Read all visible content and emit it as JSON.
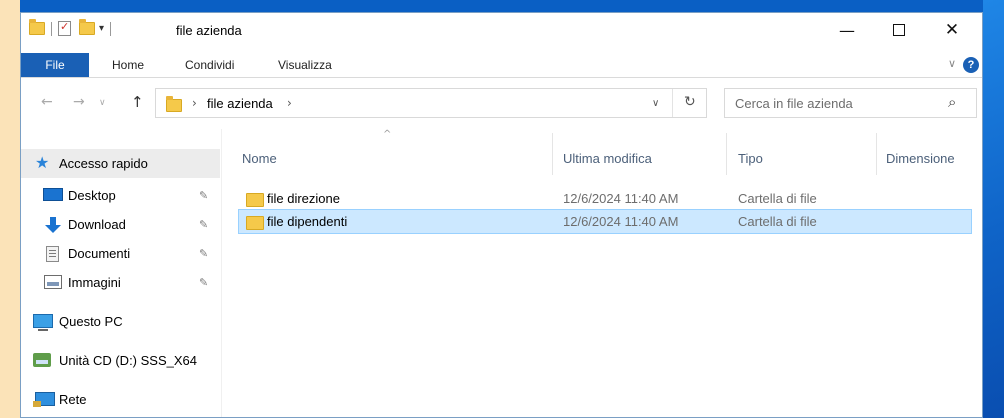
{
  "window": {
    "title": "file azienda"
  },
  "title_buttons": {
    "minimize": "—",
    "maximize": "",
    "close": "✕"
  },
  "ribbon": {
    "tabs": [
      "File",
      "Home",
      "Condividi",
      "Visualizza"
    ],
    "help": "?"
  },
  "nav": {
    "back": "←",
    "forward": "→",
    "recent": "∨",
    "up": "↑",
    "path": "file azienda",
    "dropdown": "∨",
    "refresh": "↻"
  },
  "search": {
    "placeholder": "Cerca in file azienda",
    "value": ""
  },
  "sidebar": {
    "items": [
      {
        "label": "Accesso rapido",
        "icon": "star-icon",
        "pinned": false
      },
      {
        "label": "Desktop",
        "icon": "desktop-icon",
        "pinned": true
      },
      {
        "label": "Download",
        "icon": "download-icon",
        "pinned": true
      },
      {
        "label": "Documenti",
        "icon": "documents-icon",
        "pinned": true
      },
      {
        "label": "Immagini",
        "icon": "pictures-icon",
        "pinned": true
      },
      {
        "label": "Questo PC",
        "icon": "pc-icon",
        "pinned": false
      },
      {
        "label": "Unità CD (D:) SSS_X64",
        "icon": "cd-drive-icon",
        "pinned": false
      },
      {
        "label": "Rete",
        "icon": "network-icon",
        "pinned": false
      }
    ]
  },
  "columns": {
    "name": "Nome",
    "modified": "Ultima modifica",
    "type": "Tipo",
    "size": "Dimensione"
  },
  "files": [
    {
      "name": "file direzione",
      "modified": "12/6/2024 11:40 AM",
      "type": "Cartella di file",
      "selected": false
    },
    {
      "name": "file dipendenti",
      "modified": "12/6/2024 11:40 AM",
      "type": "Cartella di file",
      "selected": true
    }
  ],
  "colors": {
    "accent": "#1a60b5",
    "selection": "#cce8ff",
    "folder": "#f5c94a"
  }
}
